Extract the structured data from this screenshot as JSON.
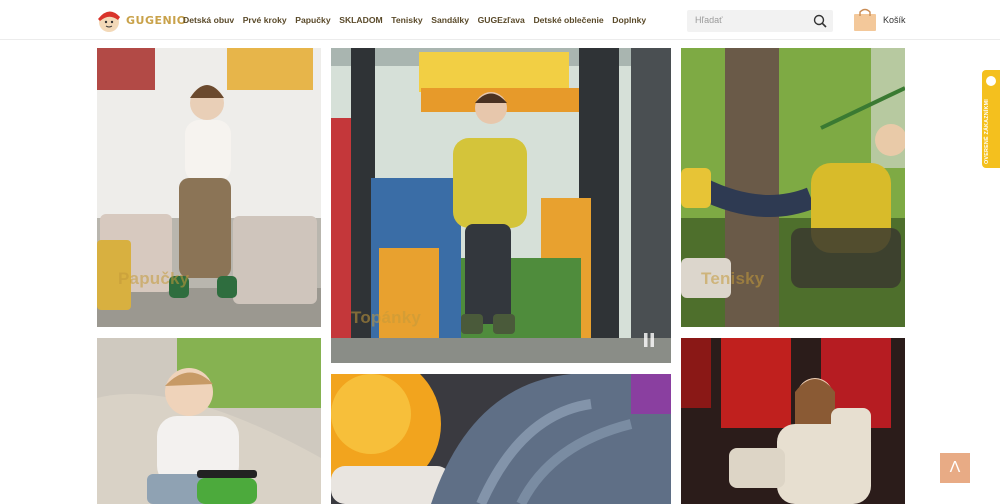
{
  "header": {
    "logo_text": "GUGENIO",
    "nav": [
      "Detská obuv",
      "Prvé kroky",
      "Papučky",
      "SKLADOM",
      "Tenisky",
      "Sandálky",
      "GUGEzľava",
      "Detské oblečenie",
      "Doplnky"
    ],
    "search_placeholder": "Hľadať",
    "cart_label": "Košík"
  },
  "tiles": {
    "papucky": "Papučky",
    "topanky": "Topánky",
    "tenisky": "Tenisky"
  },
  "side_badge": "OVERENÉ ZÁKAZNÍKMI",
  "to_top_symbol": "Λ",
  "colors": {
    "nav_text": "#5a4a2a",
    "gold": "#c49a3a",
    "badge_yellow": "#f4c01e",
    "to_top": "#e8ab85"
  }
}
